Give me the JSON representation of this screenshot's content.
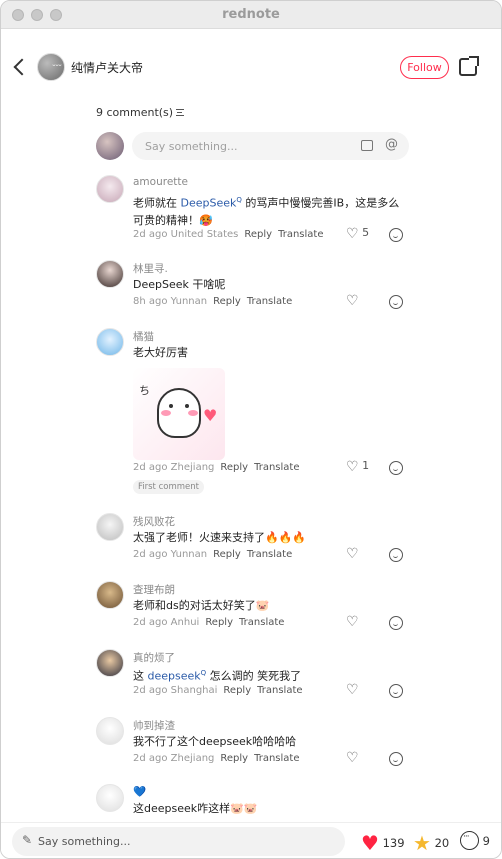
{
  "window": {
    "title": "rednote"
  },
  "header": {
    "author_name": "纯情卢关大帝",
    "avatar_tag": "ᴗᴗᴗ",
    "follow_label": "Follow"
  },
  "comments_header": {
    "count_label": "9 comment(s)"
  },
  "composer": {
    "placeholder": "Say something..."
  },
  "comments": [
    {
      "user": "amourette",
      "text_a": "老师就在 ",
      "link": "DeepSeek",
      "link_sup": "Q",
      "text_b": " 的骂声中慢慢完善IB，这是多么可贵的精神！🥵",
      "time": "2d ago",
      "location": "United States",
      "reply": "Reply",
      "translate": "Translate",
      "likes": "5"
    },
    {
      "user": "林里寻.",
      "text": "DeepSeek 干啥呢",
      "time": "8h ago",
      "location": "Yunnan",
      "reply": "Reply",
      "translate": "Translate",
      "likes": ""
    },
    {
      "user": "橘猫",
      "text": "老大好厉害",
      "sticker_text": "ち",
      "time": "2d ago",
      "location": "Zhejiang",
      "reply": "Reply",
      "translate": "Translate",
      "likes": "1",
      "badge": "First comment"
    },
    {
      "user": "残风败花",
      "text": "太强了老师！火速来支持了🔥🔥🔥",
      "time": "2d ago",
      "location": "Yunnan",
      "reply": "Reply",
      "translate": "Translate",
      "likes": ""
    },
    {
      "user": "查理布朗",
      "text": "老师和ds的对话太好笑了🐷",
      "time": "2d ago",
      "location": "Anhui",
      "reply": "Reply",
      "translate": "Translate",
      "likes": ""
    },
    {
      "user": "真的烦了",
      "text_a": "这 ",
      "link": "deepseek",
      "link_sup": "Q",
      "text_b": " 怎么调的 笑死我了",
      "time": "2d ago",
      "location": "Shanghai",
      "reply": "Reply",
      "translate": "Translate",
      "likes": ""
    },
    {
      "user": "帅到掉渣",
      "text": "我不行了这个deepseek哈哈哈哈",
      "time": "2d ago",
      "location": "Zhejiang",
      "reply": "Reply",
      "translate": "Translate",
      "likes": ""
    },
    {
      "user": "💙",
      "text": "这deepseek咋这样🐷🐷"
    }
  ],
  "bottombar": {
    "placeholder": "Say something...",
    "likes": "139",
    "stars": "20",
    "comments": "9"
  },
  "colors": {
    "accent": "#ff2e4d",
    "link": "#2a5aa8",
    "star": "#f5b82e"
  },
  "icons": [
    "back-arrow-icon",
    "share-icon",
    "sort-icon",
    "image-icon",
    "at-icon",
    "heart-outline-icon",
    "reply-bubble-icon",
    "pencil-icon",
    "heart-icon",
    "star-icon",
    "comment-bubble-icon"
  ]
}
